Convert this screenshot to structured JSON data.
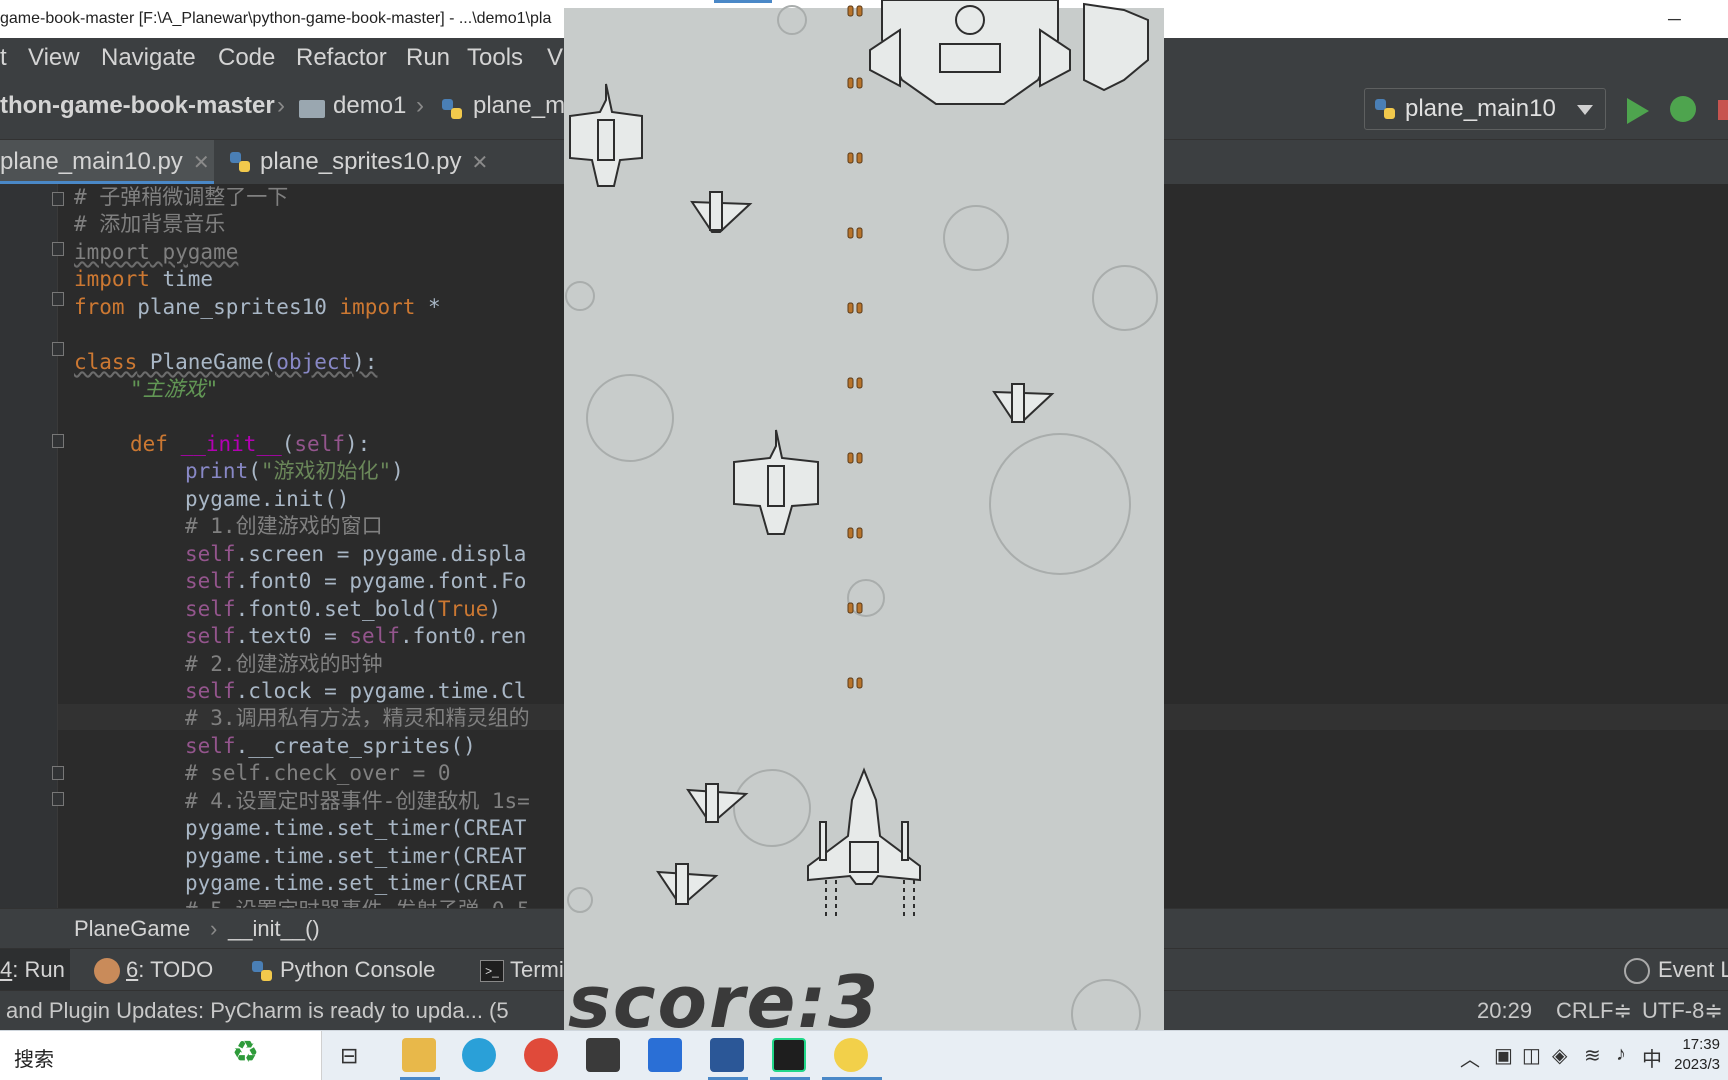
{
  "titlebar": {
    "title": "game-book-master [F:\\A_Planewar\\python-game-book-master] - ...\\demo1\\pla",
    "minimize": "─",
    "maximize": "☐"
  },
  "menu": [
    "t",
    "View",
    "Navigate",
    "Code",
    "Refactor",
    "Run",
    "Tools",
    "V"
  ],
  "nav": {
    "project": "thon-game-book-master",
    "folder": "demo1",
    "file": "plane_m",
    "run_config": "plane_main10"
  },
  "tabs": [
    {
      "label": "plane_main10.py",
      "active": true
    },
    {
      "label": "plane_sprites10.py",
      "active": false
    }
  ],
  "code": {
    "l1": "# 子弹稍微调整了一下",
    "l2": "# 添加背景音乐",
    "l3_kw": "import",
    "l3_mod": " pygame",
    "l4_kw": "import",
    "l4_mod": " time",
    "l5_kw1": "from",
    "l5_mod": " plane_sprites10 ",
    "l5_kw2": "import",
    "l5_star": " *",
    "l7_kw": "class",
    "l7_name": " PlaneGame(",
    "l7_base": "object",
    "l7_end": "):",
    "l8": "\"主游戏\"",
    "l10_kw": "def",
    "l10_fn": " __init__",
    "l10_open": "(",
    "l10_self": "self",
    "l10_end": "):",
    "l11_fn": "print",
    "l11_open": "(",
    "l11_str": "\"游戏初始化\"",
    "l11_end": ")",
    "l12": "pygame.init()",
    "l13": "# 1.创建游戏的窗口",
    "l14_self": "self",
    "l14_rest": ".screen = pygame.displa",
    "l15_self": "self",
    "l15_rest": ".font0 = pygame.font.Fo",
    "l16_self": "self",
    "l16_mid": ".font0.set_bold(",
    "l16_true": "True",
    "l16_end": ")",
    "l17_self": "self",
    "l17_mid": ".text0 = ",
    "l17_self2": "self",
    "l17_rest": ".font0.ren",
    "l18": "# 2.创建游戏的时钟",
    "l19_self": "self",
    "l19_rest": ".clock = pygame.time.Cl",
    "l20": "# 3.调用私有方法，精灵和精灵组的",
    "l21_self": "self",
    "l21_rest": ".__create_sprites()",
    "l22": "# self.check_over = 0",
    "l23": "# 4.设置定时器事件-创建敌机 1s=",
    "l24": "pygame.time.set_timer(CREAT",
    "l25": "pygame.time.set_timer(CREAT",
    "l26": "pygame.time.set_timer(CREAT",
    "l27": "# 5.设置定时器事件-发射子弹 0.5"
  },
  "bottom_crumb": {
    "a": "PlaneGame",
    "sep": "›",
    "b": "__init__()"
  },
  "toolwindows": [
    {
      "num": "4",
      "label": ": Run"
    },
    {
      "num": "6",
      "label": ": TODO"
    },
    {
      "num": "",
      "label": "Python Console"
    },
    {
      "num": "",
      "label": "Termi"
    }
  ],
  "event_log": "Event L",
  "status": {
    "message": "and Plugin Updates: PyCharm is ready to upda... (5",
    "position": "20:29",
    "line_sep": "CRLF≑",
    "encoding": "UTF-8≑"
  },
  "game": {
    "score_text": "score:3"
  },
  "taskbar": {
    "search": "搜索",
    "ime": "中",
    "time": "17:39",
    "date": "2023/3"
  }
}
